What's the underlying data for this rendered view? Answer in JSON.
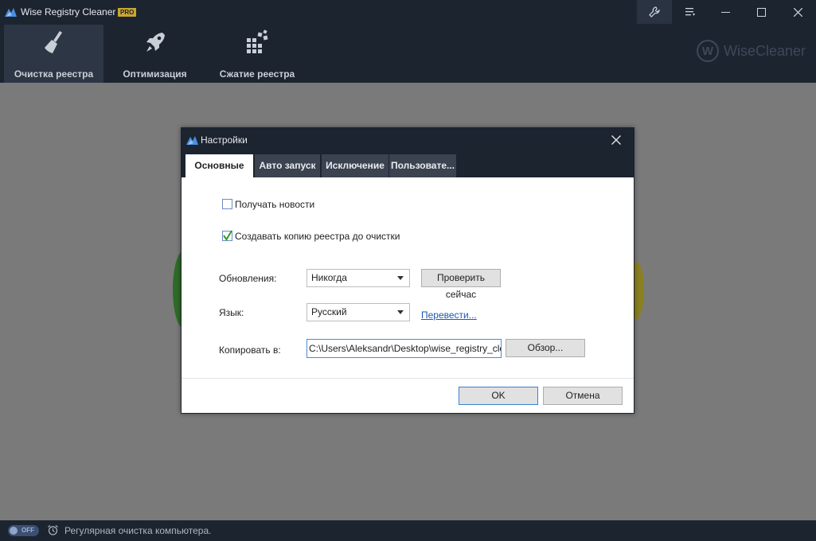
{
  "window": {
    "title": "Wise Registry Cleaner X",
    "badge": "PRO"
  },
  "toolbar": {
    "tabs": [
      {
        "label": "Очистка реестра",
        "icon": "broom-icon",
        "active": true
      },
      {
        "label": "Оптимизация",
        "icon": "rocket-icon",
        "active": false
      },
      {
        "label": "Сжатие реестра",
        "icon": "blocks-icon",
        "active": false
      }
    ],
    "brand": "WiseCleaner",
    "brand_letter": "W"
  },
  "statusbar": {
    "toggle_label": "OFF",
    "text": "Регулярная очистка компьютера."
  },
  "dialog": {
    "title": "Настройки",
    "tabs": [
      {
        "label": "Основные",
        "active": true
      },
      {
        "label": "Авто запуск",
        "active": false
      },
      {
        "label": "Исключение",
        "active": false
      },
      {
        "label": "Пользовате...",
        "active": false
      }
    ],
    "news_checkbox": {
      "label": "Получать новости",
      "checked": false
    },
    "backup_checkbox": {
      "label": "Создавать копию реестра до очистки",
      "checked": true
    },
    "updates": {
      "label": "Обновления:",
      "value": "Никогда",
      "button": "Проверить сейчас"
    },
    "language": {
      "label": "Язык:",
      "value": "Русский",
      "link": "Перевести..."
    },
    "copy_to": {
      "label": "Копировать в:",
      "value": "C:\\Users\\Aleksandr\\Desktop\\wise_registry_cle...",
      "button": "Обзор..."
    },
    "ok_label": "OK",
    "cancel_label": "Отмена"
  },
  "colors": {
    "dark_bg": "#1c2430",
    "accent_blue": "#3c7fd6",
    "link_blue": "#1a58b3",
    "check_green": "#2e9b2e",
    "pro_gold": "#caa632"
  }
}
